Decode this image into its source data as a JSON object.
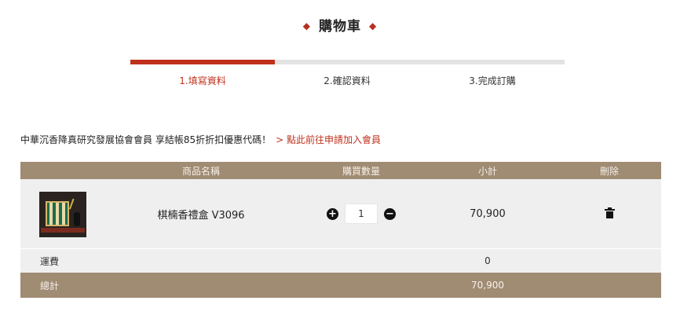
{
  "page": {
    "title": "購物車"
  },
  "steps": [
    {
      "label": "1.填寫資料"
    },
    {
      "label": "2.確認資料"
    },
    {
      "label": "3.完成訂購"
    }
  ],
  "progress": {
    "active_step": 1,
    "total_steps": 3
  },
  "promo": {
    "text": "中華沉香降真研究發展協會會員 享結帳85折折扣優惠代碼！",
    "link": "> 點此前往申請加入會員"
  },
  "table": {
    "headers": {
      "name": "商品名稱",
      "qty": "購買數量",
      "subtotal": "小計",
      "delete": "刪除"
    },
    "items": [
      {
        "name": "棋楠香禮盒 V3096",
        "quantity": "1",
        "subtotal": "70,900"
      }
    ],
    "shipping": {
      "label": "運費",
      "value": "0"
    },
    "total": {
      "label": "總計",
      "value": "70,900"
    }
  },
  "colors": {
    "accent": "#c0311d",
    "table_header": "#a08b73",
    "row_bg": "#efefef"
  }
}
